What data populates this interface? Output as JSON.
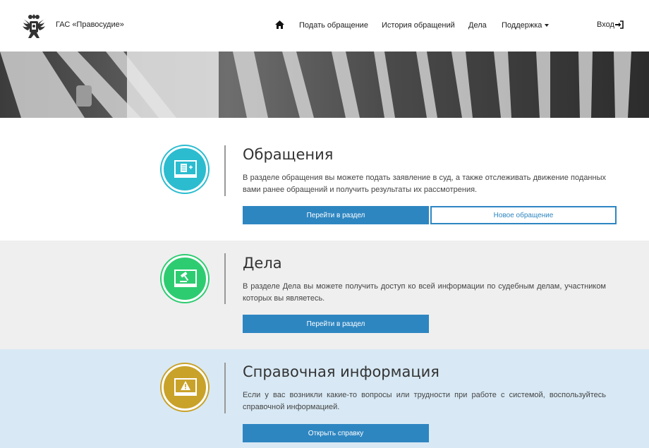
{
  "header": {
    "brand": "ГАС «Правосудие»",
    "nav": [
      {
        "label": "Подать обращение"
      },
      {
        "label": "История обращений"
      },
      {
        "label": "Дела"
      },
      {
        "label": "Поддержка"
      }
    ],
    "login": "Вход"
  },
  "sections": [
    {
      "icon": "document-laptop-icon",
      "color": "#2bbcd0",
      "title": "Обращения",
      "description": "В разделе обращения вы можете подать заявление в суд, а также отслеживать движение поданных вами ранее обращений и получить результаты их рассмотрения.",
      "primary_button": "Перейти в раздел",
      "secondary_button": "Новое обращение"
    },
    {
      "icon": "gavel-laptop-icon",
      "color": "#2ecc71",
      "title": "Дела",
      "description": "В разделе Дела вы можете получить доступ ко всей информации по судебным делам, участником которых вы являетесь.",
      "primary_button": "Перейти в раздел"
    },
    {
      "icon": "warning-laptop-icon",
      "color": "#c9a22a",
      "title": "Справочная информация",
      "description": "Если у вас возникли какие-то вопросы или трудности при работе с системой, воспользуйтесь справочной информацией.",
      "primary_button": "Открыть справку"
    }
  ]
}
